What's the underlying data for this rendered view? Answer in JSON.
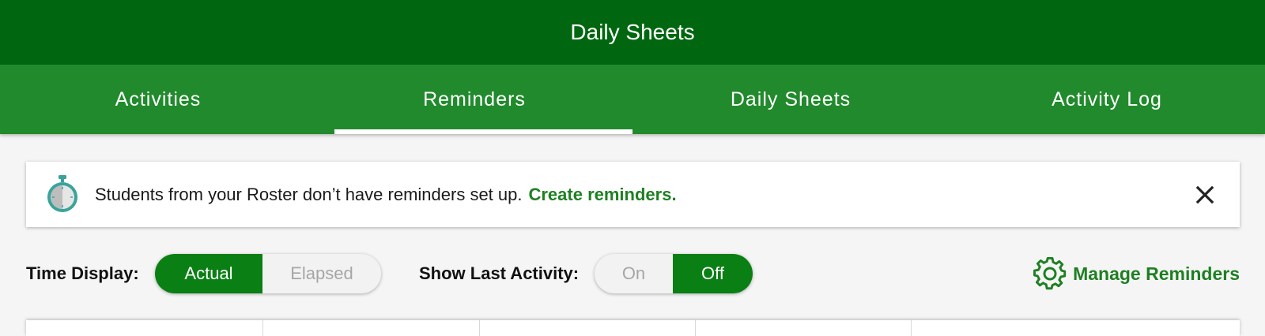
{
  "header": {
    "title": "Daily Sheets"
  },
  "tabs": [
    {
      "label": "Activities",
      "active": false
    },
    {
      "label": "Reminders",
      "active": true
    },
    {
      "label": "Daily Sheets",
      "active": false
    },
    {
      "label": "Activity Log",
      "active": false
    }
  ],
  "banner": {
    "message": "Students from your Roster don’t have reminders set up.",
    "link_label": "Create reminders.",
    "icon": "stopwatch-icon",
    "close_icon": "close-icon"
  },
  "controls": {
    "time_display": {
      "label": "Time Display:",
      "options": [
        "Actual",
        "Elapsed"
      ],
      "selected": "Actual"
    },
    "show_last_activity": {
      "label": "Show Last Activity:",
      "options": [
        "On",
        "Off"
      ],
      "selected": "Off"
    },
    "manage_reminders": {
      "label": "Manage Reminders",
      "icon": "gear-icon"
    }
  },
  "colors": {
    "header_bg": "#006710",
    "tabbar_bg": "#218a2c",
    "accent": "#0a7f14",
    "link": "#1e7f22",
    "page_bg": "#f5f5f5"
  }
}
